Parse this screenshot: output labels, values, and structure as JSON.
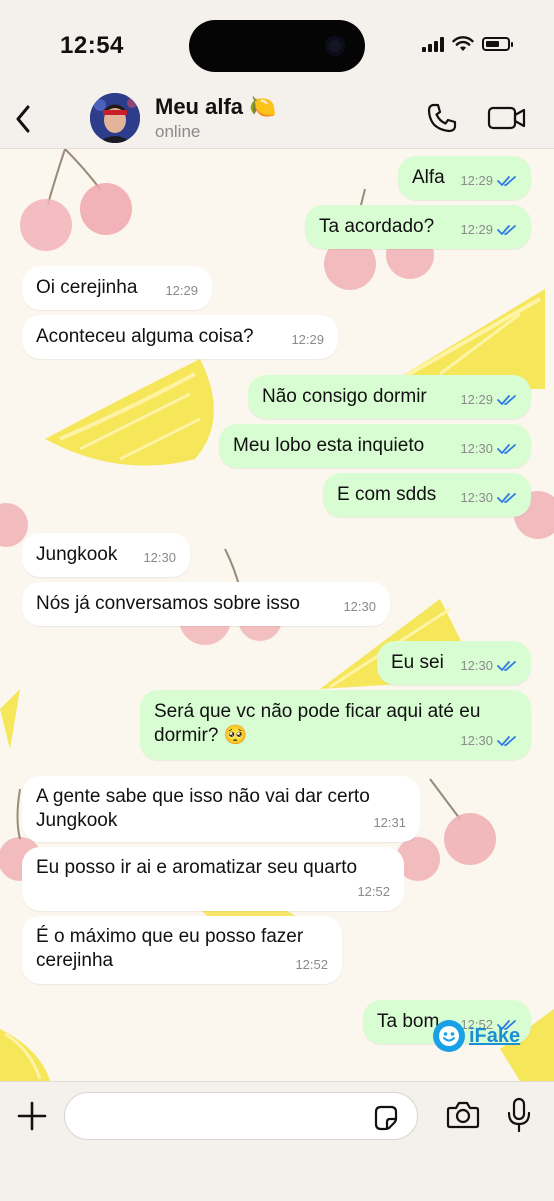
{
  "status_bar": {
    "time": "12:54"
  },
  "header": {
    "contact_name": "Meu alfa 🍋",
    "contact_status": "online"
  },
  "messages": [
    {
      "dir": "out",
      "text": "Alfa",
      "time": "12:29",
      "read": true
    },
    {
      "dir": "out",
      "text": "Ta acordado?",
      "time": "12:29",
      "read": true
    },
    {
      "dir": "in",
      "text": "Oi cerejinha",
      "time": "12:29"
    },
    {
      "dir": "in",
      "text": "Aconteceu alguma coisa?",
      "time": "12:29"
    },
    {
      "dir": "out",
      "text": "Não consigo dormir",
      "time": "12:29",
      "read": true
    },
    {
      "dir": "out",
      "text": "Meu lobo esta inquieto",
      "time": "12:30",
      "read": true
    },
    {
      "dir": "out",
      "text": "E com sdds",
      "time": "12:30",
      "read": true
    },
    {
      "dir": "in",
      "text": "Jungkook",
      "time": "12:30"
    },
    {
      "dir": "in",
      "text": "Nós já conversamos sobre isso",
      "time": "12:30"
    },
    {
      "dir": "out",
      "text": "Eu sei",
      "time": "12:30",
      "read": true
    },
    {
      "dir": "out",
      "text": "Será que vc não pode ficar aqui até eu dormir? 🥺",
      "time": "12:30",
      "read": true
    },
    {
      "dir": "in",
      "text": "A gente sabe que isso não vai dar certo Jungkook",
      "time": "12:31"
    },
    {
      "dir": "in",
      "text": "Eu posso ir ai e aromatizar seu quarto",
      "time": "12:52"
    },
    {
      "dir": "in",
      "text": "É o máximo que eu posso fazer cerejinha",
      "time": "12:52"
    },
    {
      "dir": "out",
      "text": "Ta bom",
      "time": "12:52",
      "read": true
    }
  ],
  "watermark": {
    "text": "iFake"
  },
  "input": {
    "value": ""
  },
  "icons": {
    "back": "chevron-left-icon",
    "call": "phone-icon",
    "video": "video-camera-icon",
    "attach": "plus-icon",
    "sticker": "sticker-icon",
    "camera": "camera-icon",
    "mic": "microphone-icon"
  },
  "colors": {
    "outgoing_bubble": "#d9fdd3",
    "incoming_bubble": "#ffffff",
    "read_tick": "#2c7be5",
    "chat_background": "#fbf6ee"
  }
}
